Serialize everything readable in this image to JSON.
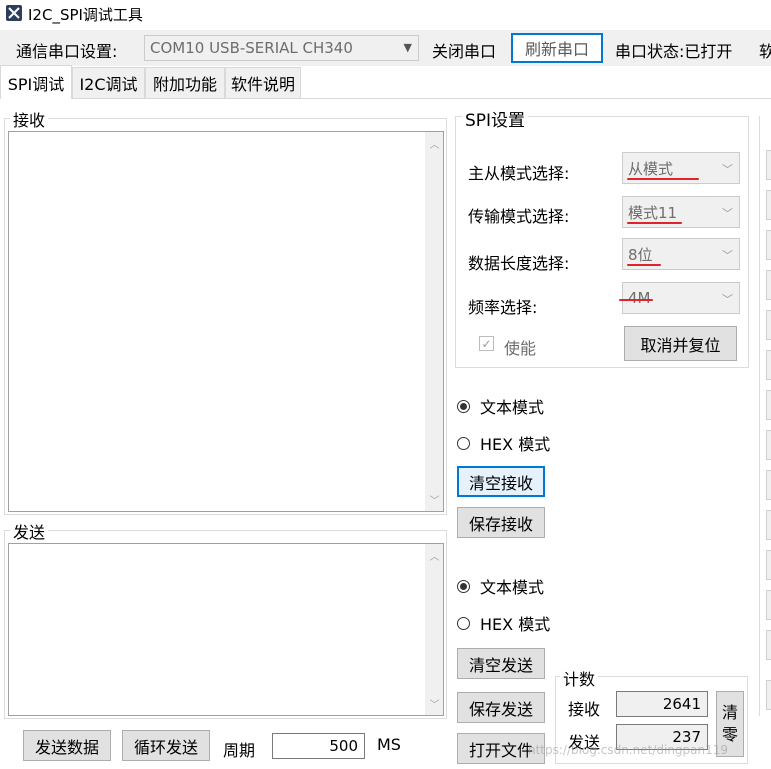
{
  "window": {
    "title": "I2C_SPI调试工具"
  },
  "toolbar": {
    "port_label": "通信串口设置:",
    "port_value": "COM10 USB-SERIAL CH340",
    "close_port": "关闭串口",
    "refresh_port": "刷新串口",
    "port_status": "串口状态:已打开",
    "overflow_text": "软"
  },
  "tabs": [
    {
      "label": "SPI调试"
    },
    {
      "label": "I2C调试"
    },
    {
      "label": "附加功能"
    },
    {
      "label": "软件说明"
    }
  ],
  "receive": {
    "title": "接收",
    "content": ""
  },
  "send": {
    "title": "发送",
    "content": ""
  },
  "spi_settings": {
    "title": "SPI设置",
    "mode_label": "主从模式选择:",
    "mode_value": "从模式",
    "transfer_label": "传输模式选择:",
    "transfer_value": "模式11",
    "length_label": "数据长度选择:",
    "length_value": "8位",
    "freq_label": "频率选择:",
    "freq_value": "4M",
    "enable_label": "使能",
    "enable_checked": true,
    "cancel_reset": "取消并复位"
  },
  "receive_controls": {
    "text_mode": "文本模式",
    "hex_mode": "HEX 模式",
    "selected": "text",
    "clear": "清空接收",
    "save": "保存接收"
  },
  "send_controls": {
    "text_mode": "文本模式",
    "hex_mode": "HEX 模式",
    "selected": "text",
    "clear": "清空发送",
    "save": "保存发送",
    "open_file": "打开文件"
  },
  "bottom": {
    "send_data": "发送数据",
    "loop_send": "循环发送",
    "period_label": "周期",
    "period_value": "500",
    "unit": "MS"
  },
  "counter": {
    "title": "计数",
    "recv_label": "接收",
    "recv_value": "2641",
    "send_label": "发送",
    "send_value": "237",
    "clear_label_1": "清",
    "clear_label_2": "零"
  },
  "watermark": "https://blog.csdn.net/dingpan119",
  "colors": {
    "accent": "#0078d7",
    "annotation": "#e0242c"
  }
}
